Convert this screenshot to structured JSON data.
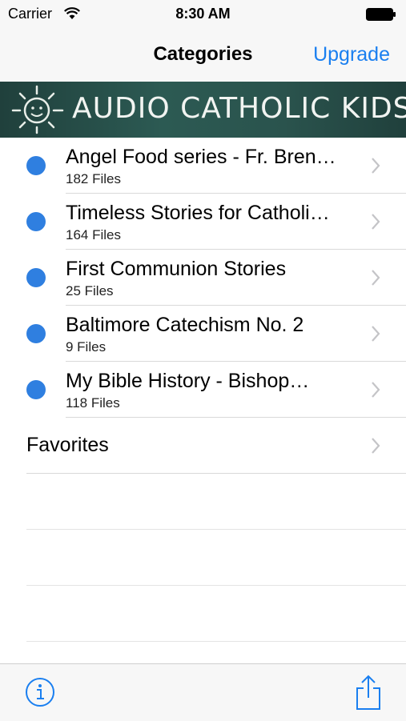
{
  "status_bar": {
    "carrier": "Carrier",
    "time": "8:30 AM",
    "wifi_icon": "wifi-icon",
    "battery_icon": "battery-icon"
  },
  "nav": {
    "title": "Categories",
    "upgrade_label": "Upgrade",
    "accent_color": "#1a7ff0"
  },
  "banner": {
    "text": "AUDIO CATHOLIC KIDS",
    "icon": "sun-icon"
  },
  "categories": [
    {
      "title": "Angel Food series - Fr. Bren…",
      "subtitle": "182 Files"
    },
    {
      "title": "Timeless Stories for Catholi…",
      "subtitle": "164 Files"
    },
    {
      "title": "First Communion Stories",
      "subtitle": "25 Files"
    },
    {
      "title": "Baltimore Catechism No. 2",
      "subtitle": "9 Files"
    },
    {
      "title": "My Bible History - Bishop…",
      "subtitle": "118 Files"
    }
  ],
  "favorites": {
    "label": "Favorites"
  },
  "toolbar": {
    "info_icon": "info-icon",
    "share_icon": "share-icon"
  },
  "colors": {
    "dot": "#2f7fe0",
    "banner_bg": "#2c5a53"
  }
}
